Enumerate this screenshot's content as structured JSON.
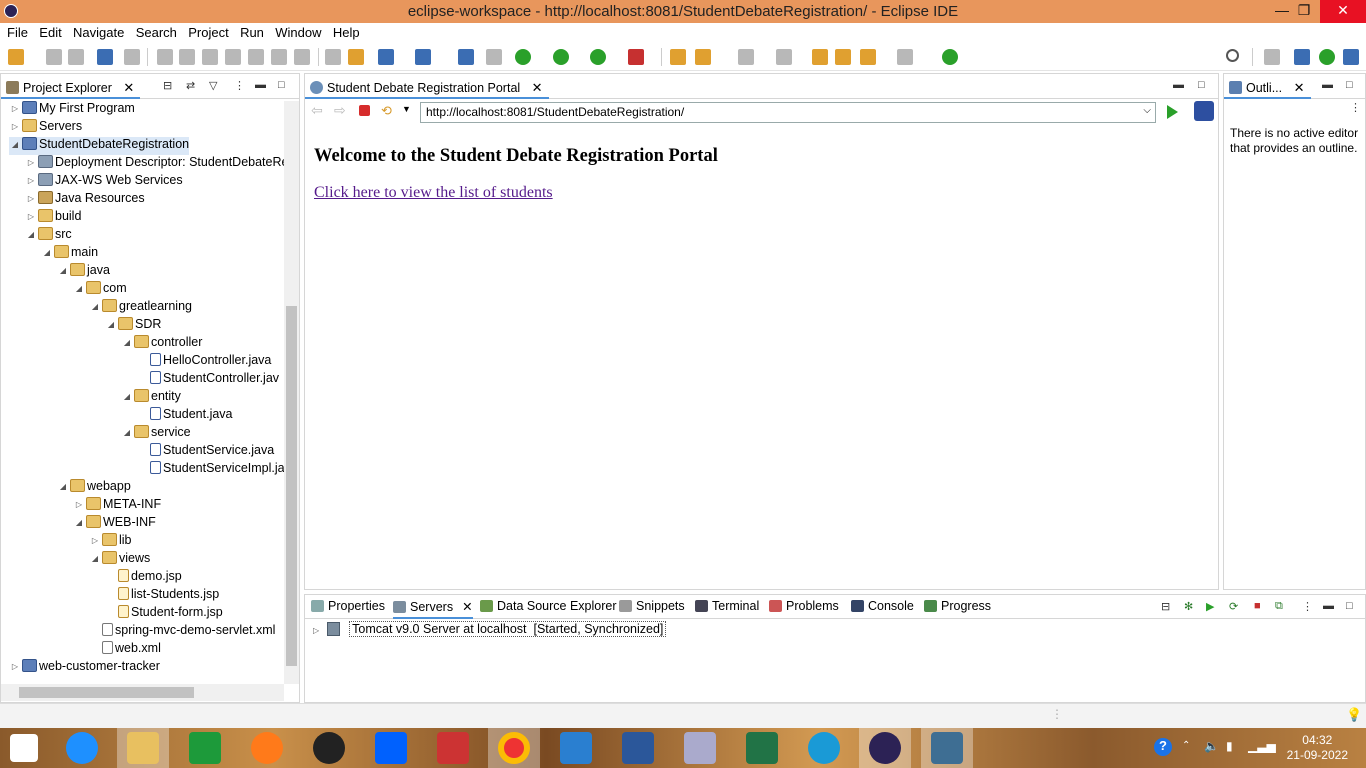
{
  "window": {
    "title": "eclipse-workspace - http://localhost:8081/StudentDebateRegistration/ - Eclipse IDE"
  },
  "menu": [
    "File",
    "Edit",
    "Navigate",
    "Search",
    "Project",
    "Run",
    "Window",
    "Help"
  ],
  "explorer": {
    "title": "Project Explorer",
    "rows": [
      {
        "label": "My First Program",
        "arrow": "▷",
        "icon": "proj",
        "depth": 0
      },
      {
        "label": "Servers",
        "arrow": "▷",
        "icon": "folder",
        "depth": 0
      },
      {
        "label": "StudentDebateRegistration",
        "arrow": "◢",
        "icon": "proj",
        "depth": 0,
        "selected": true
      },
      {
        "label": "Deployment Descriptor: StudentDebateReg",
        "arrow": "▷",
        "icon": "misc",
        "depth": 1
      },
      {
        "label": "JAX-WS Web Services",
        "arrow": "▷",
        "icon": "misc",
        "depth": 1
      },
      {
        "label": "Java Resources",
        "arrow": "▷",
        "icon": "pkg",
        "depth": 1
      },
      {
        "label": "build",
        "arrow": "▷",
        "icon": "folder",
        "depth": 1
      },
      {
        "label": "src",
        "arrow": "◢",
        "icon": "folder",
        "depth": 1
      },
      {
        "label": "main",
        "arrow": "◢",
        "icon": "folder",
        "depth": 2
      },
      {
        "label": "java",
        "arrow": "◢",
        "icon": "folder",
        "depth": 3
      },
      {
        "label": "com",
        "arrow": "◢",
        "icon": "folder",
        "depth": 4
      },
      {
        "label": "greatlearning",
        "arrow": "◢",
        "icon": "folder",
        "depth": 5
      },
      {
        "label": "SDR",
        "arrow": "◢",
        "icon": "folder",
        "depth": 6
      },
      {
        "label": "controller",
        "arrow": "◢",
        "icon": "folder",
        "depth": 7
      },
      {
        "label": "HelloController.java",
        "arrow": "",
        "icon": "java",
        "depth": 8
      },
      {
        "label": "StudentController.jav",
        "arrow": "",
        "icon": "java",
        "depth": 8
      },
      {
        "label": "entity",
        "arrow": "◢",
        "icon": "folder",
        "depth": 7
      },
      {
        "label": "Student.java",
        "arrow": "",
        "icon": "java",
        "depth": 8
      },
      {
        "label": "service",
        "arrow": "◢",
        "icon": "folder",
        "depth": 7
      },
      {
        "label": "StudentService.java",
        "arrow": "",
        "icon": "java",
        "depth": 8
      },
      {
        "label": "StudentServiceImpl.ja",
        "arrow": "",
        "icon": "java",
        "depth": 8
      },
      {
        "label": "webapp",
        "arrow": "◢",
        "icon": "folder",
        "depth": 3
      },
      {
        "label": "META-INF",
        "arrow": "▷",
        "icon": "folder",
        "depth": 4
      },
      {
        "label": "WEB-INF",
        "arrow": "◢",
        "icon": "folder",
        "depth": 4
      },
      {
        "label": "lib",
        "arrow": "▷",
        "icon": "folder",
        "depth": 5
      },
      {
        "label": "views",
        "arrow": "◢",
        "icon": "folder",
        "depth": 5
      },
      {
        "label": "demo.jsp",
        "arrow": "",
        "icon": "jsp",
        "depth": 6
      },
      {
        "label": "list-Students.jsp",
        "arrow": "",
        "icon": "jsp",
        "depth": 6
      },
      {
        "label": "Student-form.jsp",
        "arrow": "",
        "icon": "jsp",
        "depth": 6
      },
      {
        "label": "spring-mvc-demo-servlet.xml",
        "arrow": "",
        "icon": "xml",
        "depth": 5
      },
      {
        "label": "web.xml",
        "arrow": "",
        "icon": "xml",
        "depth": 5
      },
      {
        "label": "web-customer-tracker",
        "arrow": "▷",
        "icon": "proj",
        "depth": 0
      }
    ]
  },
  "editor": {
    "tab_label": "Student Debate Registration Portal",
    "url": "http://localhost:8081/StudentDebateRegistration/",
    "heading": "Welcome to the Student Debate Registration Portal",
    "link": "Click here to view the list of students"
  },
  "outline": {
    "tab_label": "Outli...",
    "message": "There is no active editor that provides an outline."
  },
  "bottom": {
    "tabs": [
      "Properties",
      "Servers",
      "Data Source Explorer",
      "Snippets",
      "Terminal",
      "Problems",
      "Console",
      "Progress"
    ],
    "server_name": "Tomcat v9.0 Server at localhost",
    "server_status": "[Started, Synchronized]"
  },
  "taskbar": {
    "time": "04:32",
    "date": "21-09-2022"
  }
}
